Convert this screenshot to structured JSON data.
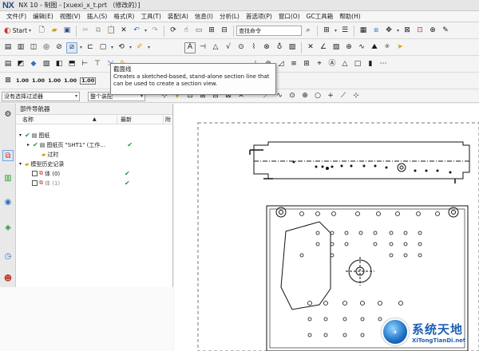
{
  "window": {
    "logo": "NX",
    "title": "NX 10 - 制图 - [xuexi_x_t.prt （修改的）]"
  },
  "menu": [
    "文件(F)",
    "编辑(E)",
    "视图(V)",
    "插入(S)",
    "格式(R)",
    "工具(T)",
    "装配(A)",
    "信息(I)",
    "分析(L)",
    "首选项(P)",
    "窗口(O)",
    "GC工具箱",
    "帮助(H)"
  ],
  "toolbar": {
    "start_label": "Start",
    "command_search_placeholder": "查找命令",
    "dimension_labels": [
      "1.00",
      "1.00",
      "1.00",
      "1.00",
      "1.00"
    ]
  },
  "filters": {
    "selection_filter": "没有选择过滤器",
    "assembly_scope": "整个装配"
  },
  "tooltip": {
    "title": "截面线",
    "body": "Creates a sketched-based, stand-alone section line that can be used to create a section view."
  },
  "navigator": {
    "title": "部件导航器",
    "columns": {
      "name": "名称",
      "latest": "最新",
      "extra": "附"
    },
    "tree": [
      {
        "label": "图纸",
        "checked": true,
        "latest": "",
        "indent": 0
      },
      {
        "label": "图纸页 \"SHT1\" (工作...",
        "checked": true,
        "latest": "✔",
        "indent": 1
      },
      {
        "label": "过时",
        "checked": false,
        "latest": "",
        "indent": 2
      },
      {
        "label": "模型历史记录",
        "checked": false,
        "latest": "",
        "indent": 0
      },
      {
        "label": "体 (0)",
        "checked": true,
        "latest": "✔",
        "indent": 1
      },
      {
        "label": "体 (1)",
        "checked": true,
        "latest": "✔",
        "indent": 1,
        "greyed": true
      }
    ]
  },
  "watermark": {
    "brand": "系统天地",
    "url": "XiTongTianDi.net"
  },
  "colors": {
    "accent": "#1d5fb3",
    "check": "#1d9b2a",
    "title_blue": "#2c4b7a"
  }
}
